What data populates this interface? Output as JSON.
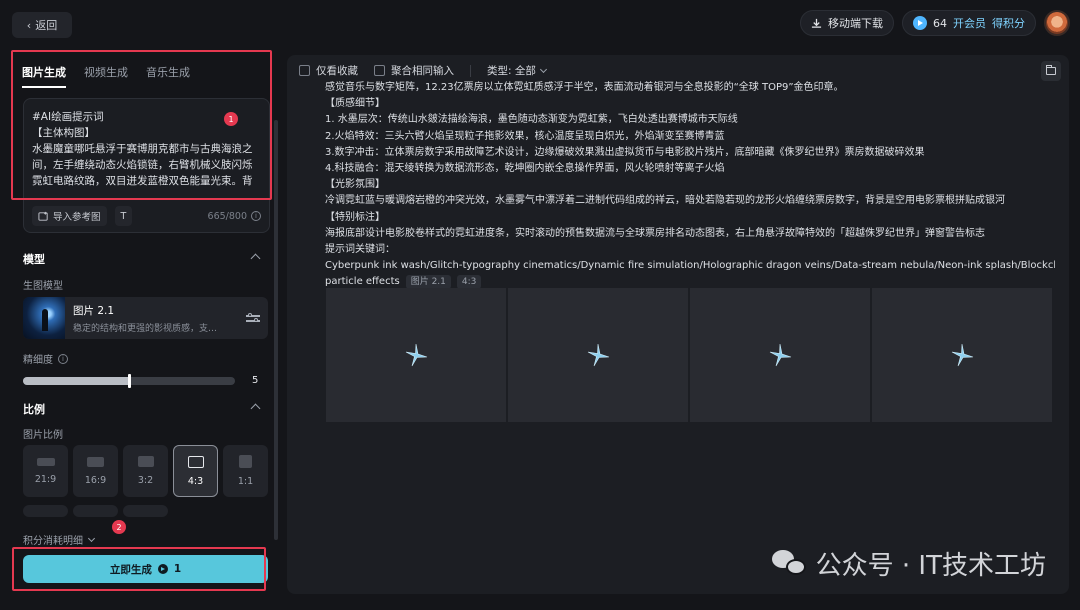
{
  "top_bar": {
    "back_label": "返回",
    "mobile_download_label": "移动端下载",
    "credits_count": "64",
    "vip_label": "开会员",
    "earn_credits_label": "得积分"
  },
  "left_panel": {
    "tabs": [
      {
        "label": "图片生成",
        "active": true
      },
      {
        "label": "视频生成",
        "active": false
      },
      {
        "label": "音乐生成",
        "active": false
      }
    ],
    "prompt": {
      "text": "#AI绘画提示词\n【主体构图】\n水墨魔童哪吒悬浮于赛博朋克都市与古典海浪之间，左手缠绕动态火焰锁链，右臂机械义肢闪烁霓虹电路纹路，双目迸发蓝橙双色能量光束。背景融合流动的赛博数据流与水墨山水...",
      "import_ref_label": "导入参考图",
      "counter": "665/800",
      "marker_1": "1"
    },
    "model_section": {
      "title": "模型",
      "sub_label": "生图模型",
      "model_name": "图片 2.1",
      "model_desc": "稳定的结构和更强的影视质感，支持..."
    },
    "detail": {
      "label": "精细度",
      "value": "5",
      "max": 10
    },
    "ratio_section": {
      "title": "比例",
      "sub_label": "图片比例",
      "options": [
        "21:9",
        "16:9",
        "3:2",
        "4:3",
        "1:1"
      ],
      "selected": "4:3"
    },
    "cost_detail_label": "积分消耗明细",
    "marker_2": "2",
    "generate_label": "立即生成",
    "generate_cost": "1"
  },
  "right_panel": {
    "filter": {
      "only_favorites_label": "仅看收藏",
      "group_inputs_label": "聚合相同输入",
      "type_label": "类型: 全部"
    },
    "lines": [
      "感觉音乐与数字矩阵，12.23亿票房以立体霓虹质感浮于半空，表面流动着银河与全息投影的“全球 TOP9”金色印章。",
      "【质感细节】",
      "1. 水墨层次：传统山水皴法描绘海浪，墨色随动态渐变为霓虹紫，飞白处透出赛博城市天际线",
      "2.火焰特效：三头六臂火焰呈现粒子拖影效果，核心温度呈现白炽光，外焰渐变至赛博青蓝",
      "3.数字冲击：立体票房数字采用故障艺术设计，边缘爆破效果溅出虚拟货币与电影胶片残片，底部暗藏《侏罗纪世界》票房数据破碎效果",
      "4.科技融合：混天绫转换为数据流形态，乾坤圈内嵌全息操作界面，风火轮喷射等离子火焰",
      "【光影氛围】",
      "冷调霓虹蓝与暖调熔岩橙的冲突光效，水墨雾气中漂浮着二进制代码组成的祥云，暗处若隐若现的龙形火焰缠绕票房数字，背景是空用电影票根拼贴成银河",
      "【特别标注】",
      "海报底部设计电影胶卷样式的霓虹进度条，实时滚动的预售数据流与全球票房排名动态图表，右上角悬浮故障特效的「超越侏罗纪世界」弹窗警告标志",
      "提示词关键词：",
      "Cyberpunk ink wash/Glitch-typography cinematics/Dynamic fire simulation/Holographic dragon veins/Data-stream nebula/Neon-ink splash/Blockchain"
    ],
    "last_line": "particle effects",
    "tag_model": "图片 2.1",
    "tag_ratio": "4:3",
    "thumbnail_count": 4
  },
  "watermark": {
    "text": "公众号 · IT技术工坊"
  }
}
